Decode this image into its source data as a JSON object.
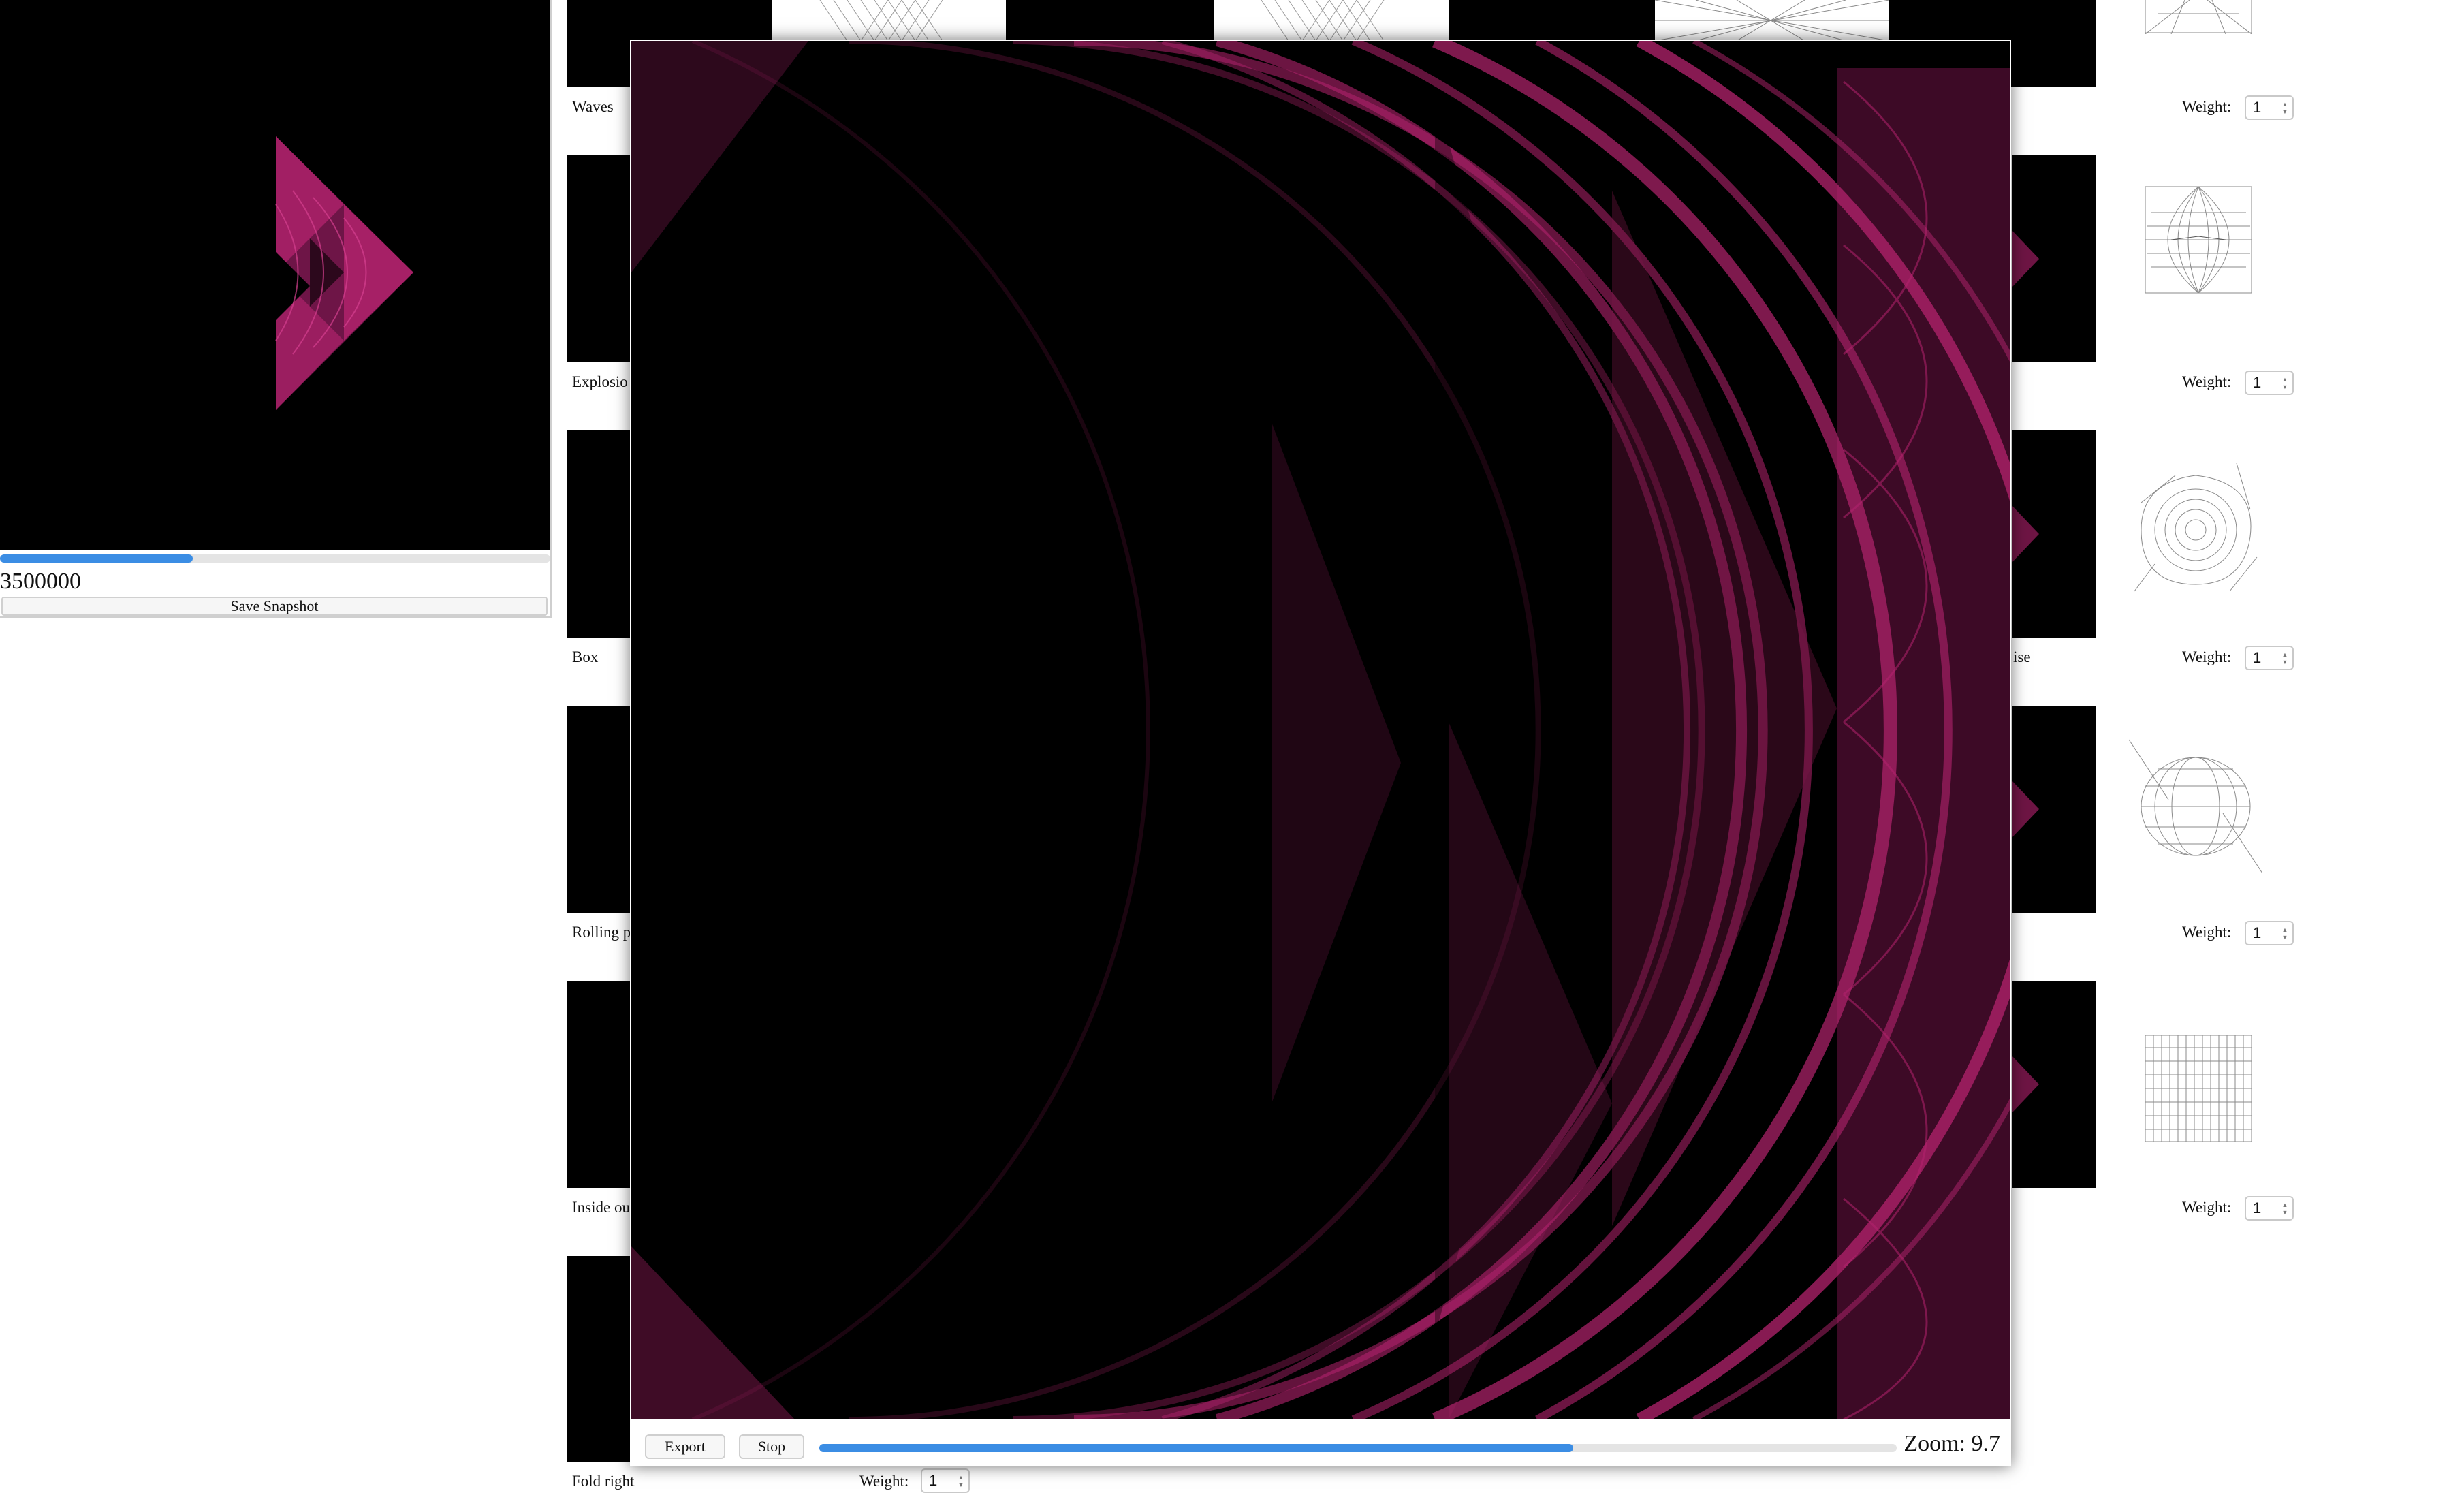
{
  "preview": {
    "count": "3500000",
    "progress_fraction": 0.35,
    "snapshot_label": "Save Snapshot"
  },
  "variations": {
    "left_labels": [
      "Waves",
      "Explosio",
      "Box",
      "Rolling p",
      "Inside ou",
      "Fold right"
    ],
    "right_partial_label": "ise",
    "weight_label": "Weight:",
    "weight_value": "1",
    "thumb_icons": [
      "bent-grid-icon",
      "lens-grid-icon",
      "swirl-grid-icon",
      "sphere-grid-icon",
      "compressed-grid-icon"
    ]
  },
  "viewer": {
    "export_label": "Export",
    "stop_label": "Stop",
    "progress_fraction": 0.7,
    "zoom_text": "Zoom: 9.7"
  },
  "colors": {
    "fractal": "#b4236e",
    "progress": "#3b8de4"
  }
}
